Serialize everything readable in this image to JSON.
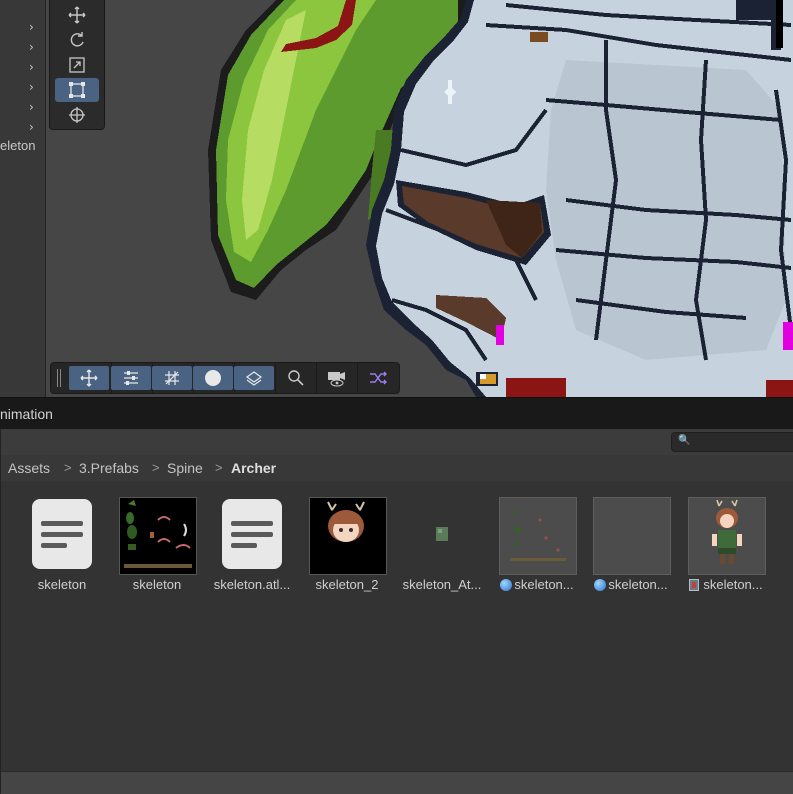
{
  "hierarchy": {
    "expand_arrows": [
      "›",
      "›",
      "›",
      "›",
      "›",
      "›"
    ],
    "partial_label": "eleton"
  },
  "scene_tools": [
    "move-tool",
    "rotate-tool",
    "scale-tool",
    "rect-tool",
    "transform-tool"
  ],
  "toolbar_bottom": [
    "move-snap",
    "grid-settings",
    "grid-toggle",
    "shading-sphere",
    "layers",
    "search",
    "scene-camera",
    "shuffle"
  ],
  "panel": {
    "tab_title": "nimation"
  },
  "search": {
    "placeholder": ""
  },
  "breadcrumb": {
    "items": [
      "Assets",
      "3.Prefabs",
      "Spine",
      "Archer"
    ],
    "separator": ">"
  },
  "assets": [
    {
      "label": "skeleton",
      "kind": "text-file"
    },
    {
      "label": "skeleton",
      "kind": "texture"
    },
    {
      "label": "skeleton.atl...",
      "kind": "text-file"
    },
    {
      "label": "skeleton_2",
      "kind": "texture-portrait"
    },
    {
      "label": "skeleton_At...",
      "kind": "small-material"
    },
    {
      "label": "skeleton...",
      "kind": "material-dots",
      "badge": "sphere-icon"
    },
    {
      "label": "skeleton...",
      "kind": "material-empty",
      "badge": "sphere-icon"
    },
    {
      "label": "skeleton...",
      "kind": "prefab-character",
      "badge": "skeleton-data-icon"
    }
  ],
  "colors": {
    "accent": "#4a6383",
    "panel": "#383838",
    "grid_bg": "#333333"
  }
}
